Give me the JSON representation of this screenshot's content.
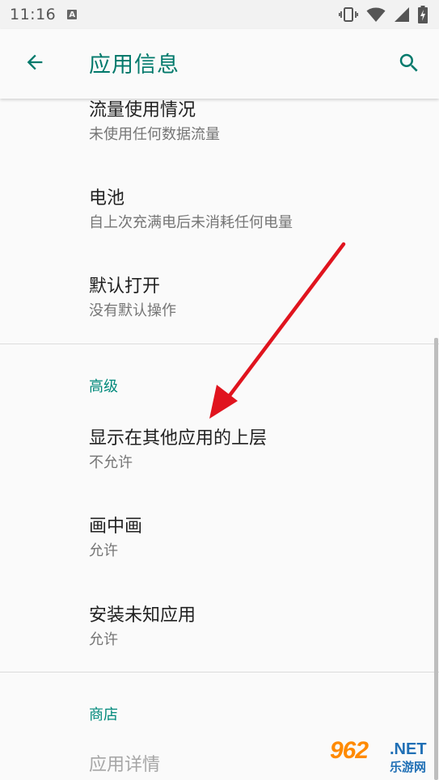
{
  "status_bar": {
    "time": "11:16",
    "notification_letter": "A"
  },
  "app_bar": {
    "title": "应用信息",
    "back_icon": "arrow-back-icon",
    "search_icon": "search-icon",
    "accent_color": "#00796b"
  },
  "items_top": [
    {
      "title": "流量使用情况",
      "summary": "未使用任何数据流量"
    },
    {
      "title": "电池",
      "summary": "自上次充满电后未消耗任何电量"
    },
    {
      "title": "默认打开",
      "summary": "没有默认操作"
    }
  ],
  "advanced": {
    "header": "高级",
    "items": [
      {
        "title": "显示在其他应用的上层",
        "summary": "不允许"
      },
      {
        "title": "画中画",
        "summary": "允许"
      },
      {
        "title": "安装未知应用",
        "summary": "允许"
      }
    ]
  },
  "store": {
    "header": "商店",
    "items": [
      {
        "title": "应用详情"
      }
    ]
  },
  "annotation": {
    "arrow_color": "#e0141e"
  },
  "watermark": {
    "number": "962",
    "suffix": ".NET",
    "text": "乐游网"
  }
}
